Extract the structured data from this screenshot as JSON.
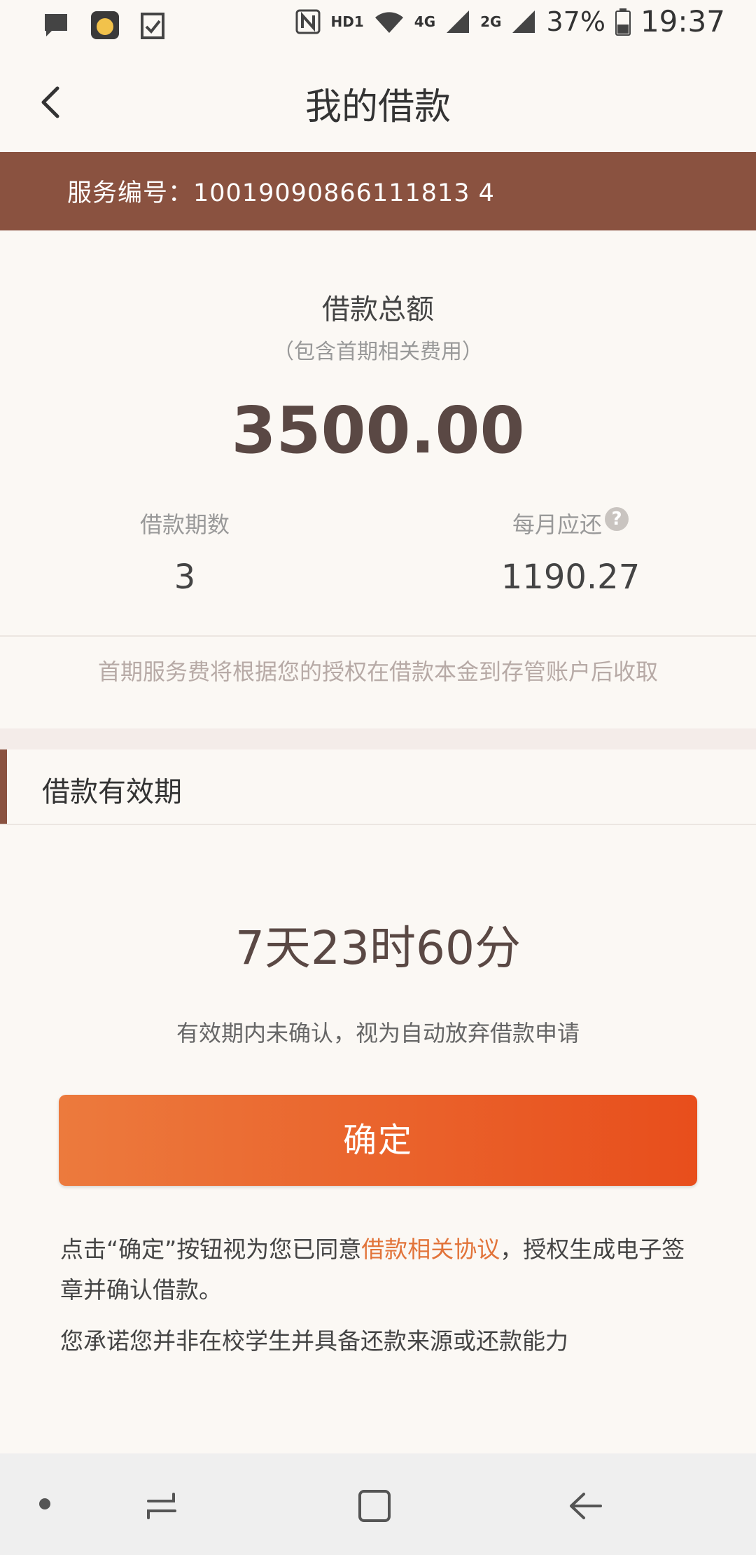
{
  "status_bar": {
    "hd_label": "HD1",
    "network_4g": "4G",
    "network_2g": "2G",
    "battery": "37%",
    "time": "19:37"
  },
  "header": {
    "title": "我的借款"
  },
  "service": {
    "text": "服务编号：10019090866111813 4"
  },
  "summary": {
    "total_label": "借款总额",
    "total_sub": "（包含首期相关费用）",
    "total_amount": "3500.00",
    "periods_label": "借款期数",
    "periods_value": "3",
    "monthly_label": "每月应还",
    "monthly_value": "1190.27",
    "fee_note": "首期服务费将根据您的授权在借款本金到存管账户后收取"
  },
  "validity": {
    "section_title": "借款有效期",
    "countdown": "7天23时60分",
    "note": "有效期内未确认，视为自动放弃借款申请"
  },
  "confirm": {
    "button_label": "确定"
  },
  "agreement": {
    "prefix": "点击“确定”按钮视为您已同意",
    "link": "借款相关协议",
    "suffix": "，授权生成电子签章并确认借款。",
    "promise": "您承诺您并非在校学生并具备还款来源或还款能力"
  },
  "colors": {
    "brand_brown": "#8a5240",
    "accent_orange": "#e84e1c",
    "link_orange": "#e2743a"
  },
  "icons": [
    "message-icon",
    "app-icon",
    "checklist-icon",
    "nfc-icon",
    "wifi-icon",
    "signal-icon",
    "battery-icon",
    "back-icon",
    "help-icon",
    "nav-dot-icon",
    "recent-apps-icon",
    "home-icon",
    "nav-back-icon"
  ]
}
